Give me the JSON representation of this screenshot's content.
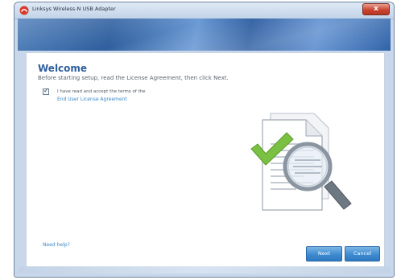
{
  "window": {
    "title": "Linksys Wireless-N USB Adapter",
    "close_label": "x",
    "app_icon": "linksys-app-icon"
  },
  "welcome": {
    "title": "Welcome",
    "subtitle": "Before starting setup, read the License Agreement, then click Next.",
    "agree_text": "I have read and accept the terms of the",
    "eula_link": "End User License Agreement",
    "checkbox_checked": true,
    "checkbox_mark": "✓"
  },
  "illustration": {
    "icon": "document-magnifier-check-icon",
    "check_color": "#7ac143"
  },
  "footer": {
    "help_link": "Need help?",
    "next_label": "Next",
    "cancel_label": "Cancel"
  },
  "colors": {
    "accent": "#2e5f9c",
    "link": "#3b86c7",
    "button": "#3e8bd1",
    "close_button": "#c8402c"
  }
}
